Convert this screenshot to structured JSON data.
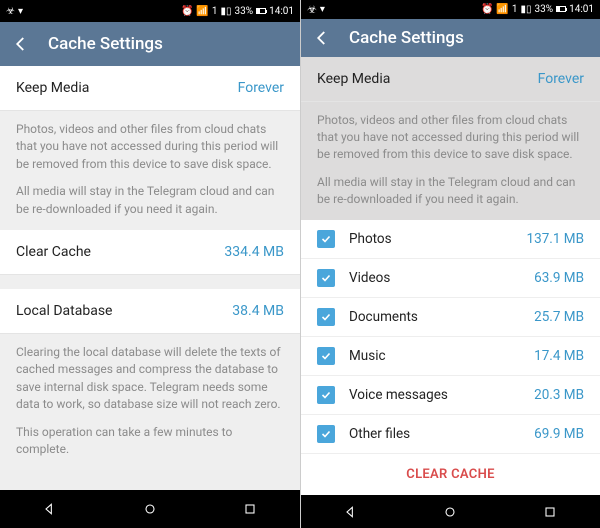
{
  "status": {
    "battery_pct": "33%",
    "time": "14:01",
    "sim": "1"
  },
  "header": {
    "title": "Cache Settings"
  },
  "left": {
    "keep_media": {
      "label": "Keep Media",
      "value": "Forever"
    },
    "desc1": "Photos, videos and other files from cloud chats that you have not accessed during this period will be removed from this device to save disk space.",
    "desc2": "All media will stay in the Telegram cloud and can be re-downloaded if you need it again.",
    "clear_cache": {
      "label": "Clear Cache",
      "value": "334.4 MB"
    },
    "local_db": {
      "label": "Local Database",
      "value": "38.4 MB"
    },
    "dbdesc1": "Clearing the local database will delete the texts of cached messages and compress the database to save internal disk space. Telegram needs some data to work, so database size will not reach zero.",
    "dbdesc2": "This operation can take a few minutes to complete."
  },
  "right": {
    "items": [
      {
        "label": "Photos",
        "size": "137.1 MB"
      },
      {
        "label": "Videos",
        "size": "63.9 MB"
      },
      {
        "label": "Documents",
        "size": "25.7 MB"
      },
      {
        "label": "Music",
        "size": "17.4 MB"
      },
      {
        "label": "Voice messages",
        "size": "20.3 MB"
      },
      {
        "label": "Other files",
        "size": "69.9 MB"
      }
    ],
    "clear_button": "CLEAR CACHE"
  }
}
